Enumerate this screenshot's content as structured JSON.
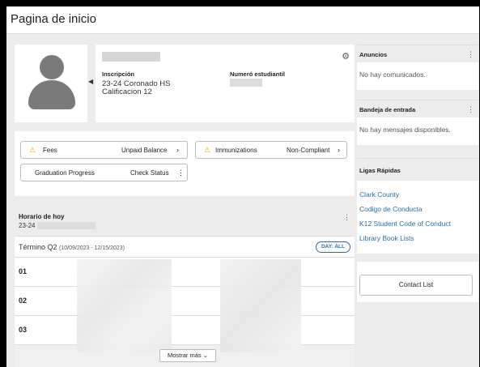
{
  "page": {
    "title": "Pagina de inicio"
  },
  "profile": {
    "inscripcion_label": "Inscripción",
    "school": "23-24 Coronado HS",
    "grade": "Calificacion 12",
    "student_number_label": "Numeró estudiantil"
  },
  "alerts": {
    "fees_label": "Fees",
    "fees_status": "Unpaid Balance",
    "immunizations_label": "Immunizations",
    "immunizations_status": "Non-Compliant",
    "graduation_label": "Graduation Progress",
    "graduation_status": "Check Status"
  },
  "schedule": {
    "title": "Horario de hoy",
    "year": "23-24",
    "term_label": "Término Q2",
    "term_dates": "(10/09/2023 - 12/15/2023)",
    "day_pill": "DAY: ALL",
    "periods": [
      "01",
      "02",
      "03"
    ],
    "more_button": "Mostrar más"
  },
  "sidebar": {
    "announcements_title": "Anuncios",
    "announcements_empty": "No hay comunicados.",
    "inbox_title": "Bandeja de entrada",
    "inbox_empty": "No hay mensajes disponibles.",
    "quick_links_title": "Ligas Rápidas",
    "quick_links": [
      "Clark County",
      "Codigo de Conducta",
      "K12 Student Code of Conduct",
      "Library Book Lists"
    ],
    "contact_button": "Contact List"
  },
  "icons": {
    "gear": "gear-icon",
    "warning": "warning-icon",
    "kebab": "more-vertical-icon",
    "chevron": "chevron-right-icon"
  },
  "colors": {
    "link": "#2d6ca2",
    "warning": "#f0a000"
  }
}
